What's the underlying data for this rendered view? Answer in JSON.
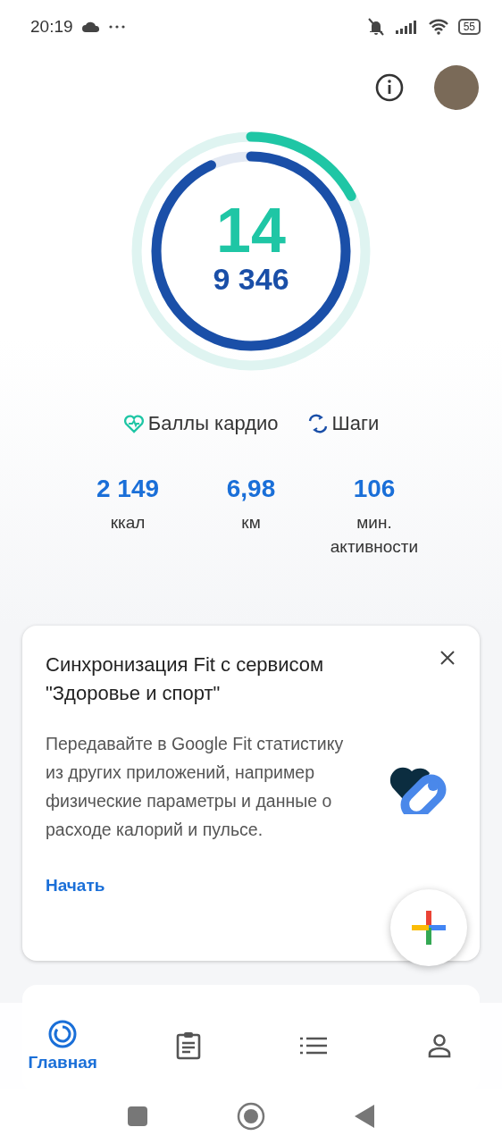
{
  "status_bar": {
    "time": "20:19",
    "battery": "55"
  },
  "rings": {
    "cardio": {
      "value": "14",
      "level": 0.17
    },
    "steps": {
      "value": "9 346",
      "level": 0.93
    }
  },
  "legend": [
    {
      "kind": "heart",
      "label": "Баллы кардио"
    },
    {
      "kind": "steps",
      "label": "Шаги"
    }
  ],
  "stats": [
    {
      "value": "2 149",
      "label": "ккал"
    },
    {
      "value": "6,98",
      "label": "км"
    },
    {
      "value": "106",
      "label": "мин. активности"
    }
  ],
  "sync_card": {
    "title": "Синхронизация Fit с сервисом \"Здоровье и спорт\"",
    "body": "Передавайте в Google Fit статистику из других приложений, например физические параметры и данные о расходе калорий и пульсе.",
    "action": "Начать"
  },
  "bottom_nav": [
    {
      "kind": "home",
      "label": "Главная",
      "selected": true
    },
    {
      "kind": "journal",
      "selected": false
    },
    {
      "kind": "browse",
      "selected": false
    },
    {
      "kind": "profile",
      "selected": false
    }
  ]
}
